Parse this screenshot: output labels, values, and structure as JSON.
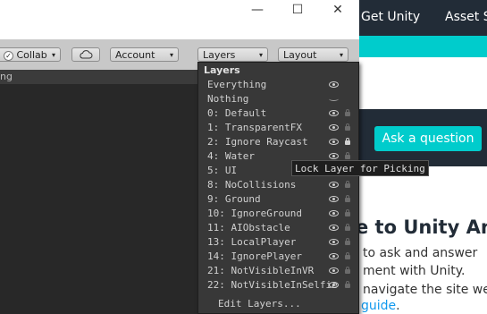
{
  "window": {
    "minimize_glyph": "—",
    "maximize_glyph": "☐",
    "close_glyph": "✕"
  },
  "toolbar": {
    "collab_label": "Collab",
    "account_label": "Account",
    "layers_label": "Layers",
    "layout_label": "Layout",
    "dropdown_arrow": "▾"
  },
  "hierarchy": {
    "label_fragment": "ng"
  },
  "layers_menu": {
    "header": "Layers",
    "items": [
      {
        "label": "Everything",
        "eye": "visible",
        "lock": null
      },
      {
        "label": "Nothing",
        "eye": "hidden",
        "lock": null
      },
      {
        "label": "0: Default",
        "eye": "visible",
        "lock": "unlocked"
      },
      {
        "label": "1: TransparentFX",
        "eye": "visible",
        "lock": "unlocked"
      },
      {
        "label": "2: Ignore Raycast",
        "eye": "visible",
        "lock": "locked"
      },
      {
        "label": "4: Water",
        "eye": "visible",
        "lock": "unlocked"
      },
      {
        "label": "5: UI",
        "eye": "visible",
        "lock": "unlocked"
      },
      {
        "label": "8: NoCollisions",
        "eye": "visible",
        "lock": "unlocked"
      },
      {
        "label": "9: Ground",
        "eye": "visible",
        "lock": "unlocked"
      },
      {
        "label": "10: IgnoreGround",
        "eye": "visible",
        "lock": "unlocked"
      },
      {
        "label": "11: AIObstacle",
        "eye": "visible",
        "lock": "unlocked"
      },
      {
        "label": "13: LocalPlayer",
        "eye": "visible",
        "lock": "unlocked"
      },
      {
        "label": "14: IgnorePlayer",
        "eye": "visible",
        "lock": "unlocked"
      },
      {
        "label": "21: NotVisibleInVR",
        "eye": "visible",
        "lock": "unlocked"
      },
      {
        "label": "22: NotVisibleInSelfie",
        "eye": "visible",
        "lock": "unlocked"
      }
    ],
    "edit_label": "Edit Layers..."
  },
  "tooltip": {
    "text": "Lock Layer for Picking"
  },
  "website": {
    "nav_links": [
      "Get Unity",
      "Asset S"
    ],
    "ask_button": "Ask a question",
    "heading": "e to Unity An",
    "lines": [
      "to ask and answer",
      "ment with Unity.",
      "navigate the site we"
    ],
    "guide_link": "guide",
    "guide_suffix": ".",
    "colors": {
      "nav_bg": "#222c37",
      "accent": "#00cccc",
      "link": "#1199ee"
    }
  }
}
